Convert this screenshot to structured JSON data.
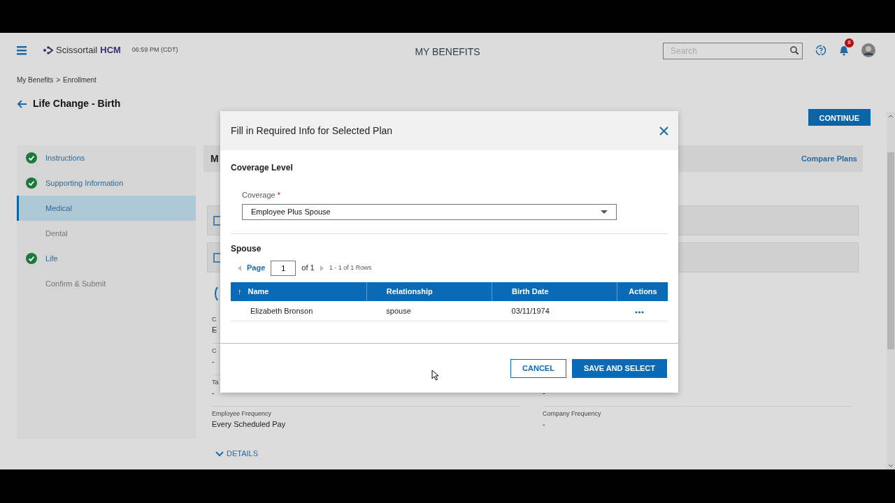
{
  "header": {
    "brand": {
      "name": "Scissortail",
      "suffix": "HCM"
    },
    "time": "06:59 PM (CDT)",
    "title": "MY BENEFITS",
    "search": {
      "placeholder": "Search"
    },
    "notifications": {
      "count": "8"
    }
  },
  "breadcrumb": {
    "items": [
      "My Benefits",
      "Enrollment"
    ],
    "separator": ">"
  },
  "page_heading": "Life Change - Birth",
  "continue_button": "CONTINUE",
  "steps": [
    {
      "label": "Instructions",
      "completed": true,
      "selected": false
    },
    {
      "label": "Supporting Information",
      "completed": true,
      "selected": false
    },
    {
      "label": "Medical",
      "completed": false,
      "selected": true
    },
    {
      "label": "Dental",
      "completed": false,
      "selected": false
    },
    {
      "label": "Life",
      "completed": true,
      "selected": false
    },
    {
      "label": "Confirm & Submit",
      "completed": false,
      "selected": false
    }
  ],
  "panel": {
    "title": "M",
    "link": "Compare Plans",
    "cards": [
      {
        "checked": false
      },
      {
        "checked": false
      }
    ],
    "fields": [
      {
        "left": {
          "label": "C",
          "value": "E"
        }
      },
      {
        "left": {
          "label": "C",
          "value": "-"
        }
      },
      {
        "left": {
          "label": "Ta",
          "value": "-"
        },
        "right": {
          "value": "-"
        }
      },
      {
        "left": {
          "label": "Employee Frequency",
          "value": "Every Scheduled Pay"
        },
        "right": {
          "label": "Company Frequency",
          "value": "-"
        }
      }
    ],
    "details_toggle": "DETAILS"
  },
  "modal": {
    "title": "Fill in Required Info for Selected Plan",
    "section": "Coverage Level",
    "coverage": {
      "label": "Coverage",
      "required_mark": "*",
      "value": "Employee Plus Spouse"
    },
    "table_title": "Spouse",
    "pager": {
      "page_label": "Page",
      "page": "1",
      "of": "of 1",
      "range": "1 - 1 of 1 Rows"
    },
    "columns": [
      {
        "label": "Name",
        "sort_icon": "↑"
      },
      {
        "label": "Relationship"
      },
      {
        "label": "Birth Date"
      },
      {
        "label": "Actions"
      }
    ],
    "rows": [
      {
        "name": "Elizabeth Bronson",
        "relationship": "spouse",
        "birth_date": "03/11/1974"
      }
    ],
    "buttons": [
      {
        "label": "CANCEL",
        "kind": "secondary"
      },
      {
        "label": "SAVE AND SELECT",
        "kind": "primary"
      }
    ]
  }
}
